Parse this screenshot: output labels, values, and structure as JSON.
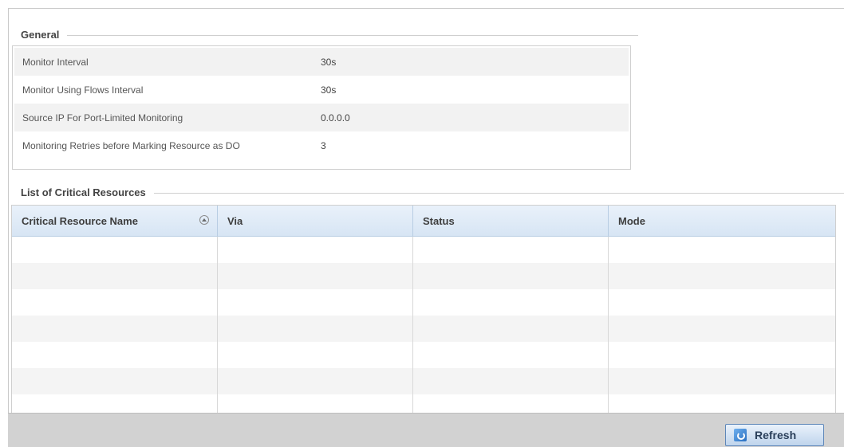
{
  "general": {
    "title": "General",
    "rows": [
      {
        "label": "Monitor Interval",
        "value": "30s"
      },
      {
        "label": "Monitor Using Flows Interval",
        "value": "30s"
      },
      {
        "label": "Source IP For Port-Limited Monitoring",
        "value": "0.0.0.0"
      },
      {
        "label": "Monitoring Retries before Marking Resource as DO",
        "value": "3"
      }
    ]
  },
  "critical_resources": {
    "title": "List of Critical Resources",
    "columns": [
      "Critical Resource Name",
      "Via",
      "Status",
      "Mode"
    ],
    "sort_column": "Critical Resource Name",
    "rows": []
  },
  "footer": {
    "refresh_label": "Refresh"
  },
  "icons": {
    "sort": "sort-ascending-icon",
    "refresh": "refresh-icon"
  },
  "colors": {
    "header_gradient_top": "#e9f1fa",
    "header_gradient_bottom": "#d7e5f4",
    "footer_bar": "#d2d2d2",
    "button_border": "#5d86b8"
  }
}
